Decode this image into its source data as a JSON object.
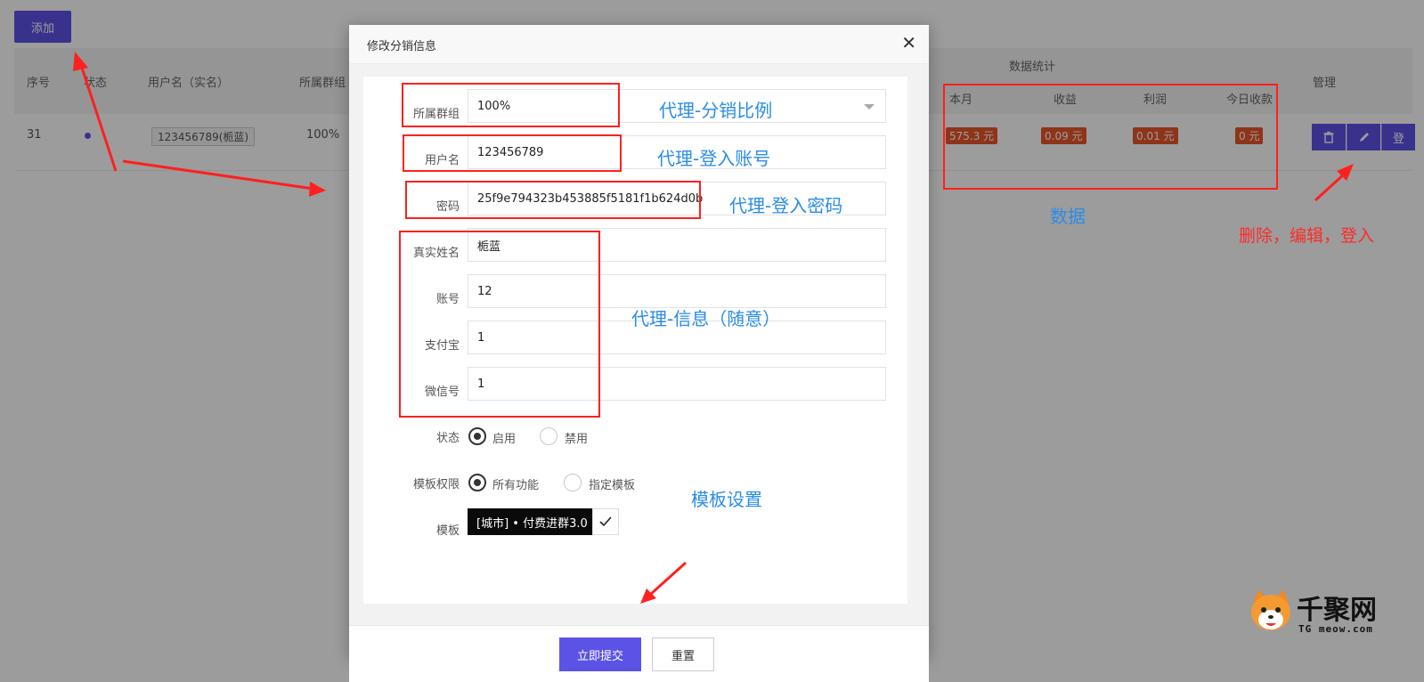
{
  "toolbar": {
    "add_label": "添加"
  },
  "table": {
    "group_header": "数据统计",
    "headers": {
      "seq": "序号",
      "status": "状态",
      "username": "用户名（实名）",
      "group": "所属群组",
      "month": "本月",
      "income": "收益",
      "profit": "利润",
      "today": "今日收款",
      "manage": "管理"
    },
    "row": {
      "seq": "31",
      "username": "123456789(栀蓝)",
      "group": "100%",
      "month": "575.3 元",
      "income": "0.09 元",
      "profit": "0.01 元",
      "today": "0 元"
    },
    "actions": {
      "delete_icon": "trash-icon",
      "edit_icon": "pencil-icon",
      "login_label": "登"
    }
  },
  "modal": {
    "title": "修改分销信息",
    "close": "✕",
    "fields": {
      "group_label": "所属群组",
      "group_value": "100%",
      "username_label": "用户名",
      "username_value": "123456789",
      "password_label": "密码",
      "password_value": "25f9e794323b453885f5181f1b624d0b",
      "realname_label": "真实姓名",
      "realname_value": "栀蓝",
      "account_label": "账号",
      "account_value": "12",
      "alipay_label": "支付宝",
      "alipay_value": "1",
      "wechat_label": "微信号",
      "wechat_value": "1"
    },
    "status": {
      "label": "状态",
      "opt_enable": "启用",
      "opt_disable": "禁用",
      "selected": "启用"
    },
    "permission": {
      "label": "模板权限",
      "opt_all": "所有功能",
      "opt_specific": "指定模板",
      "selected": "所有功能"
    },
    "template": {
      "label": "模板",
      "value": "[城市] • 付费进群3.0"
    },
    "footer": {
      "submit": "立即提交",
      "reset": "重置"
    }
  },
  "annotations": {
    "group_ratio": "代理-分销比例",
    "login_account": "代理-登入账号",
    "login_password": "代理-登入密码",
    "info": "代理-信息（随意）",
    "template": "模板设置",
    "data": "数据",
    "actions": "删除，编辑，登入"
  },
  "watermark": {
    "title": "千聚网",
    "sub": "TG meow.com"
  },
  "colors": {
    "primary": "#5c53e6",
    "badge": "#e8562a",
    "annotation_red": "#ff2020",
    "annotation_blue": "#2a8ce8"
  }
}
